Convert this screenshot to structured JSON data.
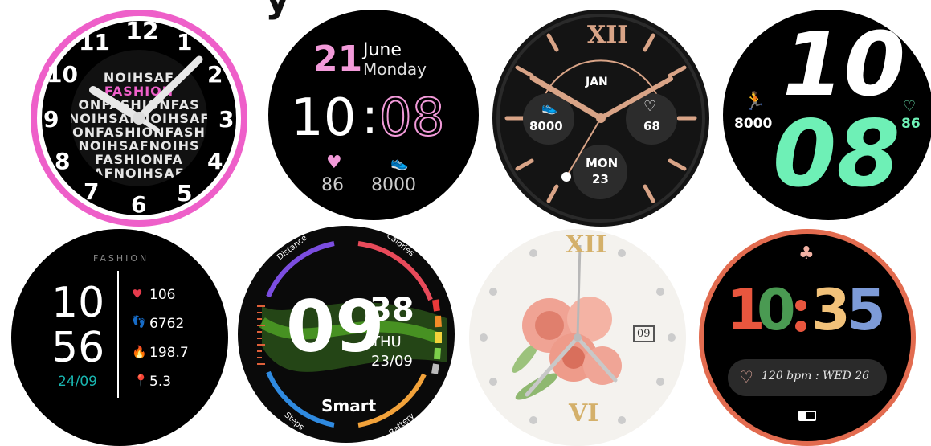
{
  "title_fragment": "y",
  "faces": {
    "f1": {
      "brand": "FASHION",
      "pattern": [
        "NOIHSAF",
        "FASHIONFA",
        "ONFASHIONFAS",
        "NOIHSAFNOIHSAF",
        "ONFASHIONFASH",
        "NOIHSAFNOIHS",
        "FASHIONFA",
        "AFNOIHSAF"
      ],
      "numerals": [
        "12",
        "1",
        "2",
        "3",
        "4",
        "5",
        "6",
        "7",
        "8",
        "9",
        "10",
        "11"
      ],
      "ring_color": "#ee5fc9"
    },
    "f2": {
      "day": "21",
      "month": "June",
      "weekday": "Monday",
      "hour": "10",
      "colon": ":",
      "minute": "08",
      "heart_value": "86",
      "steps_value": "8000",
      "accent": "#f29ad9"
    },
    "f3": {
      "roman_top": "XII",
      "month": "JAN",
      "steps": "8000",
      "heart": "68",
      "weekday": "MON",
      "day": "23",
      "accent": "#d9a487"
    },
    "f4": {
      "hour": "10",
      "minute": "08",
      "steps": "8000",
      "heart": "86",
      "accent": "#6ef0b6"
    },
    "f5": {
      "brand": "FASHION",
      "hour": "10",
      "minute": "56",
      "date": "24/09",
      "heart": "106",
      "steps": "6762",
      "calories": "198.7",
      "distance": "5.3",
      "date_color": "#19b5b0"
    },
    "f6": {
      "label_distance": "Distance",
      "label_calories": "Calories",
      "label_steps": "Steps",
      "label_battery": "Battery",
      "hour": "09",
      "minute": "38",
      "weekday": "THU",
      "date": "23/09",
      "brand": "Smart"
    },
    "f7": {
      "roman_top": "XII",
      "roman_bottom": "VI",
      "date": "09"
    },
    "f8": {
      "d1": "1",
      "d2": "0",
      "d3": "3",
      "d4": "5",
      "pill_text": "120 bpm : WED 26",
      "ring_color": "#e26b4f"
    }
  }
}
